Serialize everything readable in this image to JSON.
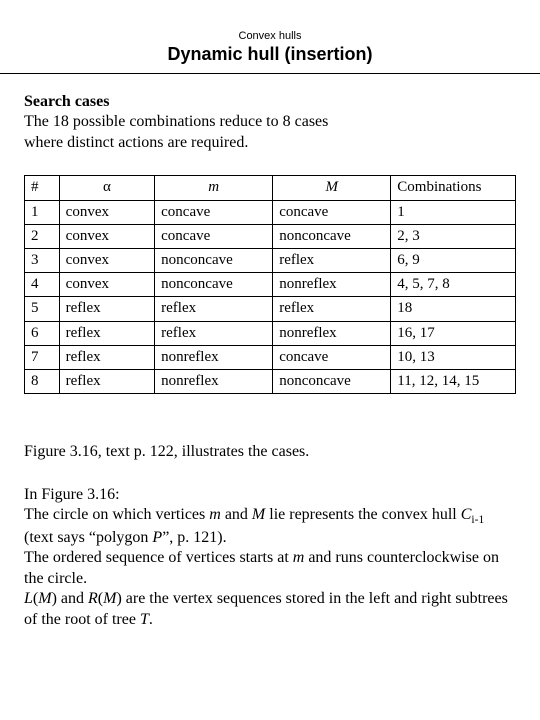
{
  "header": {
    "topic": "Convex hulls",
    "title": "Dynamic hull (insertion)"
  },
  "intro": {
    "heading": "Search cases",
    "line1": "The 18 possible combinations reduce to 8 cases",
    "line2": "where distinct actions are required."
  },
  "table": {
    "headers": {
      "num": "#",
      "alpha": "α",
      "m": "m",
      "mm": "M",
      "comb": "Combinations"
    },
    "rows": [
      {
        "num": "1",
        "alpha": "convex",
        "m": "concave",
        "mm": "concave",
        "comb": "1"
      },
      {
        "num": "2",
        "alpha": "convex",
        "m": "concave",
        "mm": "nonconcave",
        "comb": "2, 3"
      },
      {
        "num": "3",
        "alpha": "convex",
        "m": "nonconcave",
        "mm": "reflex",
        "comb": "6, 9"
      },
      {
        "num": "4",
        "alpha": "convex",
        "m": "nonconcave",
        "mm": "nonreflex",
        "comb": "4, 5, 7, 8"
      },
      {
        "num": "5",
        "alpha": "reflex",
        "m": "reflex",
        "mm": "reflex",
        "comb": "18"
      },
      {
        "num": "6",
        "alpha": "reflex",
        "m": "reflex",
        "mm": "nonreflex",
        "comb": "16, 17"
      },
      {
        "num": "7",
        "alpha": "reflex",
        "m": "nonreflex",
        "mm": "concave",
        "comb": "10, 13"
      },
      {
        "num": "8",
        "alpha": "reflex",
        "m": "nonreflex",
        "mm": "nonconcave",
        "comb": "11, 12, 14, 15"
      }
    ]
  },
  "footer": {
    "fig_ref": "Figure 3.16, text p. 122, illustrates the cases.",
    "p2_lead": "In Figure 3.16:",
    "p2_a1": "The circle on which vertices ",
    "p2_m": "m",
    "p2_a2": " and ",
    "p2_mm": "M",
    "p2_a3": " lie represents the convex hull ",
    "p2_c": "C",
    "p2_csub": "i-1",
    "p2_a4": " (text says “polygon ",
    "p2_p": "P",
    "p2_a5": "”, p. 121).",
    "p3_a1": "The ordered sequence of vertices starts at ",
    "p3_m": "m",
    "p3_a2": " and runs counterclockwise on the circle.",
    "p4_l": "L",
    "p4_a1": "(",
    "p4_m1": "M",
    "p4_a2": ") and ",
    "p4_r": "R",
    "p4_a3": "(",
    "p4_m2": "M",
    "p4_a4": ") are the vertex sequences stored in the left and right subtrees of the root of tree ",
    "p4_t": "T",
    "p4_a5": "."
  }
}
